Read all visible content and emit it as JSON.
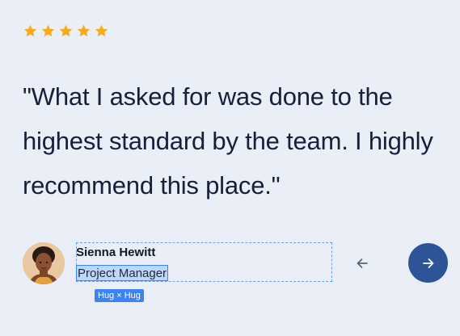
{
  "rating": {
    "stars": 5,
    "color": "#f6ab1c"
  },
  "testimonial": {
    "quote": "\"What I asked for was done to the highest standard by the team. I highly recommend this place.\""
  },
  "author": {
    "name": "Sienna Hewitt",
    "role": "Project Manager",
    "avatar_icon": "person-avatar"
  },
  "selection": {
    "badge_label": "Hug × Hug",
    "accent": "#3b82f6"
  },
  "navigation": {
    "prev_icon": "arrow-left-icon",
    "next_icon": "arrow-right-icon",
    "next_color": "#2d5497"
  }
}
